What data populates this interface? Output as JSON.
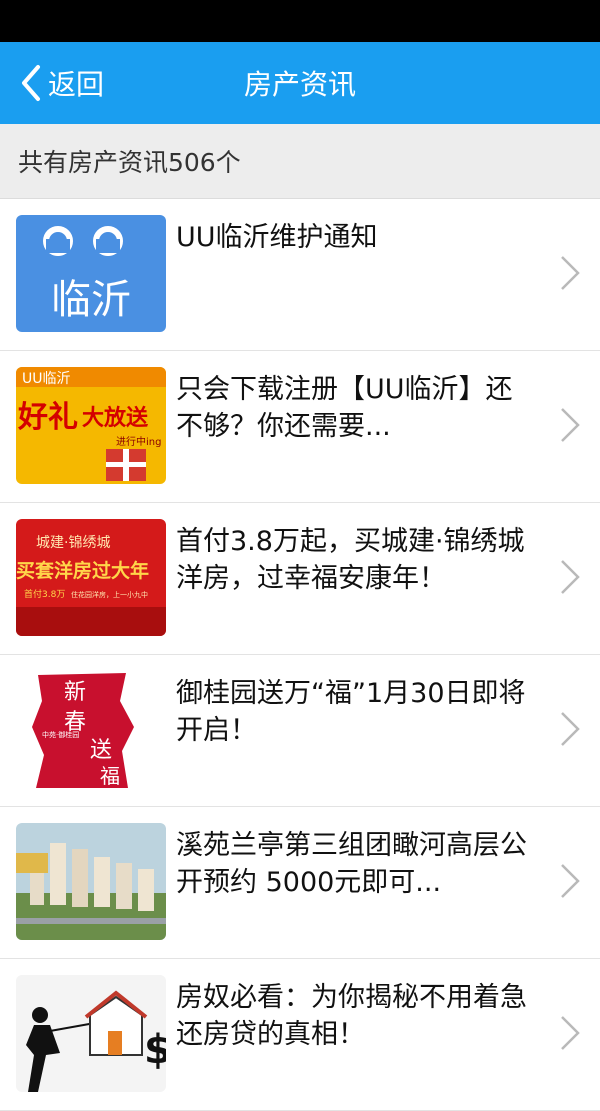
{
  "header": {
    "back_label": "返回",
    "title": "房产资讯"
  },
  "count_text": "共有房产资讯506个",
  "items": [
    {
      "title": "UU临沂维护通知",
      "thumb_text": "临沂"
    },
    {
      "title": "只会下载注册【UU临沂】还不够？你还需要...",
      "thumb_text": [
        "UU临沂",
        "好礼",
        "大放送",
        "进行中ing"
      ]
    },
    {
      "title": "首付3.8万起，买城建·锦绣城洋房，过幸福安康年！",
      "thumb_text": [
        "城建·锦绣城",
        "买套洋房过大年",
        "首付3.8万",
        "住花园洋房，上一小九中"
      ]
    },
    {
      "title": "御桂园送万“福”1月30日即将开启！",
      "thumb_text": [
        "新",
        "春",
        "送",
        "福",
        "中苑·御桂园"
      ]
    },
    {
      "title": "溪苑兰亭第三组团瞰河高层公开预约 5000元即可...",
      "thumb_text": []
    },
    {
      "title": "房奴必看：为你揭秘不用着急还房贷的真相！",
      "thumb_text": [
        "$"
      ]
    }
  ],
  "colors": {
    "header_bg": "#1a9ef0",
    "status_bg": "#000000",
    "count_bg": "#ededed"
  }
}
